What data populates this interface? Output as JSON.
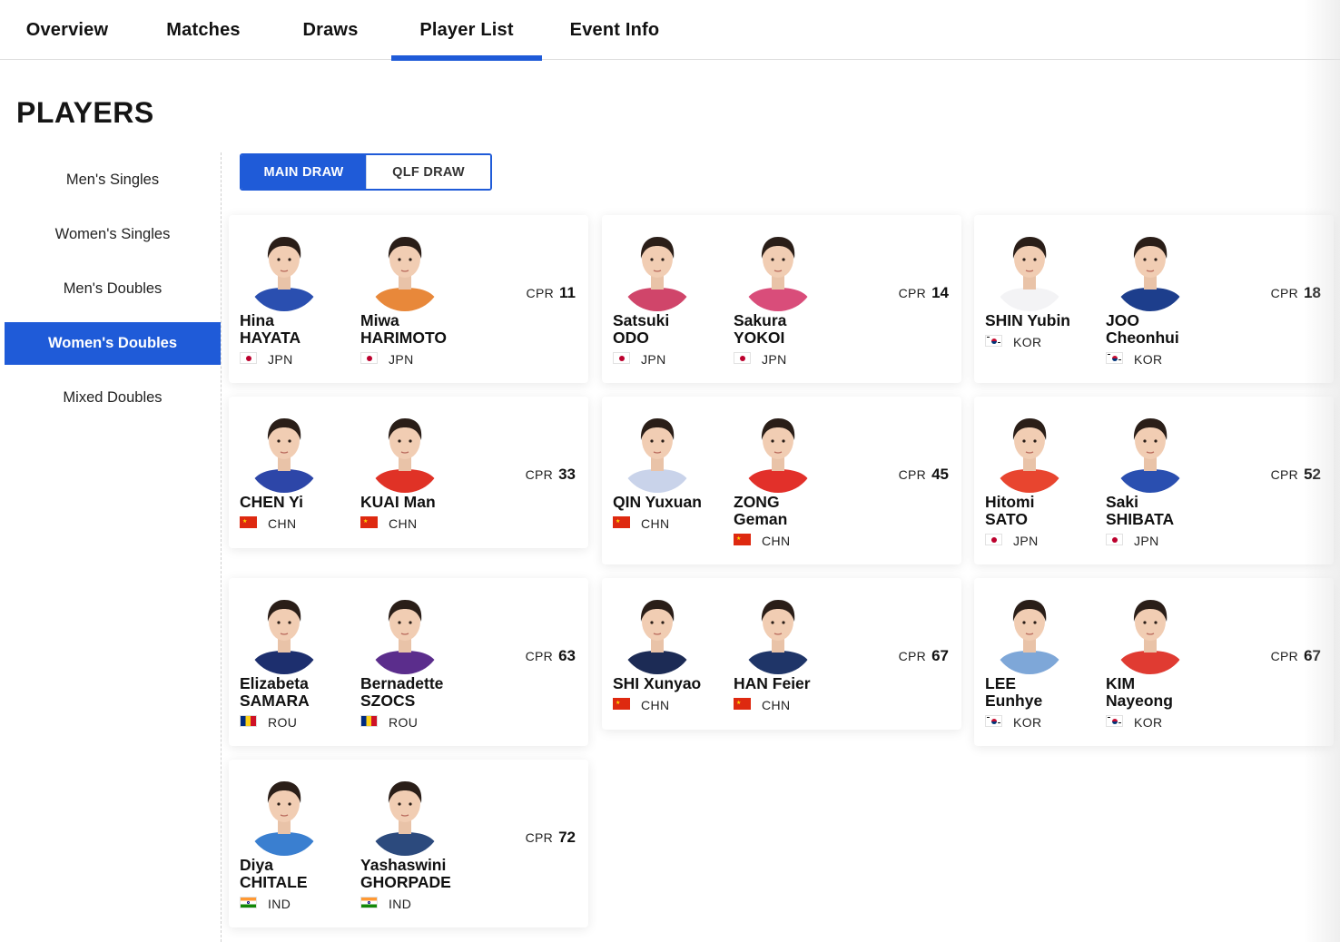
{
  "tabs": [
    "Overview",
    "Matches",
    "Draws",
    "Player List",
    "Event Info"
  ],
  "active_tab": "Player List",
  "heading": "PLAYERS",
  "sidebar": {
    "items": [
      "Men's Singles",
      "Women's Singles",
      "Men's Doubles",
      "Women's Doubles",
      "Mixed Doubles"
    ],
    "active": "Women's Doubles"
  },
  "draw_toggle": {
    "main": "MAIN DRAW",
    "qlf": "QLF DRAW",
    "active": "MAIN DRAW"
  },
  "cpr_label": "CPR",
  "colors": {
    "accent": "#1f5bd8"
  },
  "pairs": [
    {
      "cpr": "11",
      "players": [
        {
          "name": "Hina\nHAYATA",
          "country": "JPN",
          "jersey": "#2a4fb0"
        },
        {
          "name": "Miwa\nHARIMOTO",
          "country": "JPN",
          "jersey": "#e8883a"
        }
      ]
    },
    {
      "cpr": "14",
      "players": [
        {
          "name": "Satsuki\nODO",
          "country": "JPN",
          "jersey": "#d0456a"
        },
        {
          "name": "Sakura\nYOKOI",
          "country": "JPN",
          "jersey": "#d94d7a"
        }
      ]
    },
    {
      "cpr": "18",
      "players": [
        {
          "name": "SHIN Yubin",
          "country": "KOR",
          "jersey": "#f3f3f5"
        },
        {
          "name": "JOO\nCheonhui",
          "country": "KOR",
          "jersey": "#1d3e8c"
        }
      ]
    },
    {
      "cpr": "33",
      "players": [
        {
          "name": "CHEN Yi",
          "country": "CHN",
          "jersey": "#2d46a8"
        },
        {
          "name": "KUAI Man",
          "country": "CHN",
          "jersey": "#e03226"
        }
      ]
    },
    {
      "cpr": "45",
      "players": [
        {
          "name": "QIN Yuxuan",
          "country": "CHN",
          "jersey": "#c9d3ea"
        },
        {
          "name": "ZONG\nGeman",
          "country": "CHN",
          "jersey": "#e2302a"
        }
      ]
    },
    {
      "cpr": "52",
      "players": [
        {
          "name": "Hitomi\nSATO",
          "country": "JPN",
          "jersey": "#e8452f"
        },
        {
          "name": "Saki\nSHIBATA",
          "country": "JPN",
          "jersey": "#2a4fb0"
        }
      ]
    },
    {
      "cpr": "63",
      "players": [
        {
          "name": "Elizabeta\nSAMARA",
          "country": "ROU",
          "jersey": "#1d2f6e"
        },
        {
          "name": "Bernadette\nSZOCS",
          "country": "ROU",
          "jersey": "#5b2d8c"
        }
      ]
    },
    {
      "cpr": "67",
      "players": [
        {
          "name": "SHI Xunyao",
          "country": "CHN",
          "jersey": "#1c2b55"
        },
        {
          "name": "HAN Feier",
          "country": "CHN",
          "jersey": "#1f3568"
        }
      ]
    },
    {
      "cpr": "67",
      "players": [
        {
          "name": "LEE\nEunhye",
          "country": "KOR",
          "jersey": "#7ea7d8"
        },
        {
          "name": "KIM\nNayeong",
          "country": "KOR",
          "jersey": "#e03b32"
        }
      ]
    },
    {
      "cpr": "72",
      "players": [
        {
          "name": "Diya\nCHITALE",
          "country": "IND",
          "jersey": "#3a7fd0"
        },
        {
          "name": "Yashaswini\nGHORPADE",
          "country": "IND",
          "jersey": "#2c4a7d"
        }
      ]
    }
  ]
}
